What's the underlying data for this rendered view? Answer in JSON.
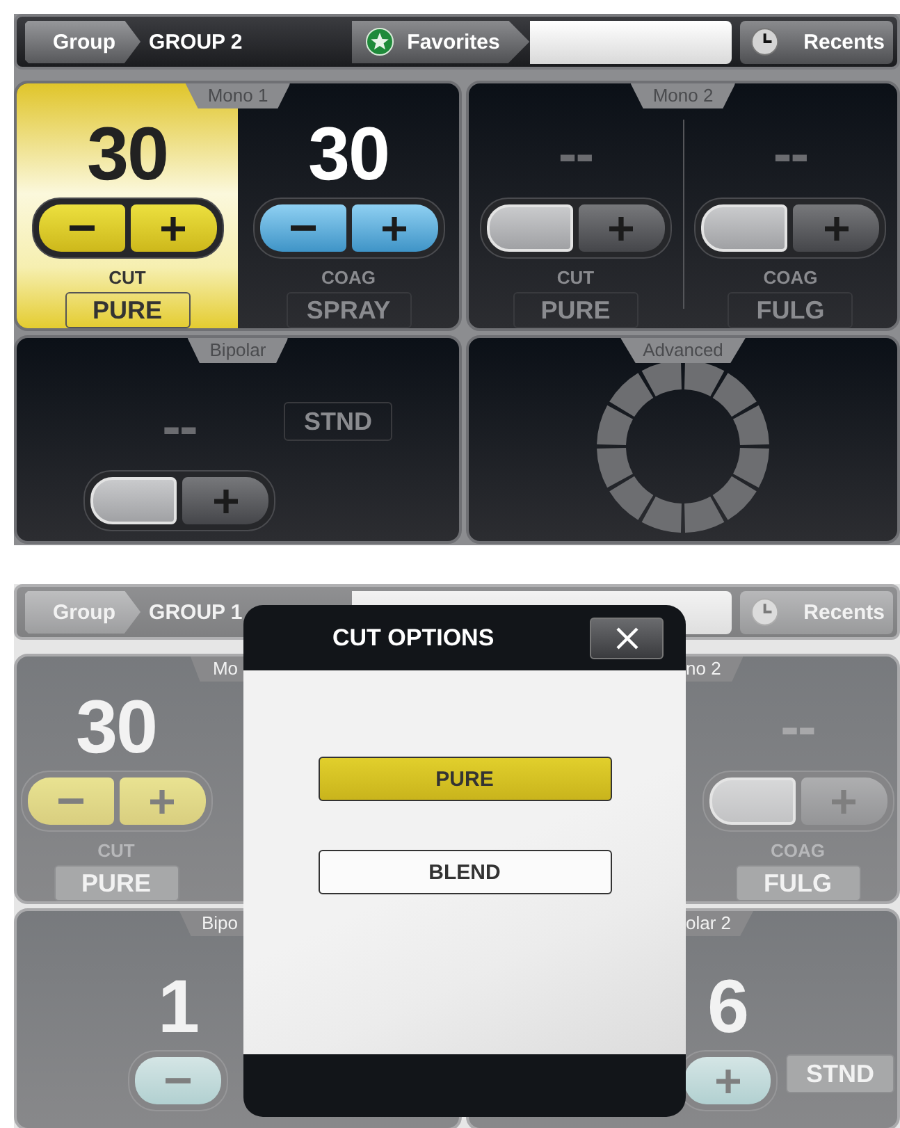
{
  "screens": [
    {
      "kind": "main",
      "header": {
        "group_button": "Group",
        "group_name": "GROUP 2",
        "favorites_button": "Favorites",
        "recents_button": "Recents"
      },
      "panels": [
        {
          "kind": "mono",
          "title": "Mono 1",
          "channels": [
            {
              "label": "CUT",
              "value": "30",
              "mode": "PURE",
              "kind": "cut",
              "enabled": true,
              "selected": true,
              "buttons": [
                {
                  "kind": "minus"
                },
                {
                  "kind": "plus"
                }
              ]
            },
            {
              "label": "COAG",
              "value": "30",
              "mode": "SPRAY",
              "kind": "coag",
              "enabled": true,
              "selected": false,
              "buttons": [
                {
                  "kind": "minus"
                },
                {
                  "kind": "plus"
                }
              ]
            }
          ]
        },
        {
          "kind": "mono",
          "title": "Mono 2",
          "channels": [
            {
              "label": "CUT",
              "value": "--",
              "mode": "PURE",
              "kind": "cut",
              "enabled": false,
              "selected": false,
              "buttons": [
                {
                  "kind": "minus"
                },
                {
                  "kind": "plus"
                }
              ]
            },
            {
              "label": "COAG",
              "value": "--",
              "mode": "FULG",
              "kind": "coag",
              "enabled": false,
              "selected": false,
              "buttons": [
                {
                  "kind": "minus"
                },
                {
                  "kind": "plus"
                }
              ]
            }
          ]
        },
        {
          "kind": "bipolar",
          "title": "Bipolar",
          "channels": [
            {
              "value": "--",
              "mode": "STND",
              "kind": "bipolar",
              "enabled": false,
              "selected": false,
              "buttons": [
                {
                  "kind": "minus"
                },
                {
                  "kind": "plus"
                }
              ]
            }
          ]
        },
        {
          "kind": "advanced",
          "title": "Advanced"
        }
      ]
    },
    {
      "kind": "dimmed",
      "header": {
        "group_button": "Group",
        "group_name": "GROUP 1",
        "recents_button": "Recents"
      },
      "panels": [
        {
          "kind": "mono",
          "title": "Mo",
          "channels": [
            {
              "label": "CUT",
              "value": "30",
              "mode": "PURE",
              "kind": "cut",
              "enabled": true,
              "selected": false,
              "buttons": [
                {
                  "kind": "minus"
                },
                {
                  "kind": "plus"
                }
              ]
            }
          ]
        },
        {
          "kind": "mono",
          "title": "no 2",
          "channels": [
            {
              "label": "COAG",
              "value": "--",
              "mode": "FULG",
              "kind": "coag",
              "enabled": false,
              "selected": false,
              "buttons": [
                {
                  "kind": "minus"
                },
                {
                  "kind": "plus"
                }
              ]
            }
          ]
        },
        {
          "kind": "bipolar",
          "title": "Bipo",
          "channels": [
            {
              "value": "1",
              "kind": "bipolar",
              "enabled": true,
              "selected": false,
              "buttons": [
                {
                  "kind": "minus"
                }
              ]
            }
          ]
        },
        {
          "kind": "bipolar",
          "title": "olar 2",
          "channels": [
            {
              "value": "6",
              "mode": "STND",
              "kind": "bipolar",
              "enabled": true,
              "selected": false,
              "buttons": [
                {
                  "kind": "plus"
                }
              ]
            }
          ]
        }
      ],
      "dialog": {
        "title": "CUT OPTIONS",
        "options": [
          {
            "label": "PURE",
            "selected": true
          },
          {
            "label": "BLEND",
            "selected": false
          }
        ]
      }
    }
  ]
}
